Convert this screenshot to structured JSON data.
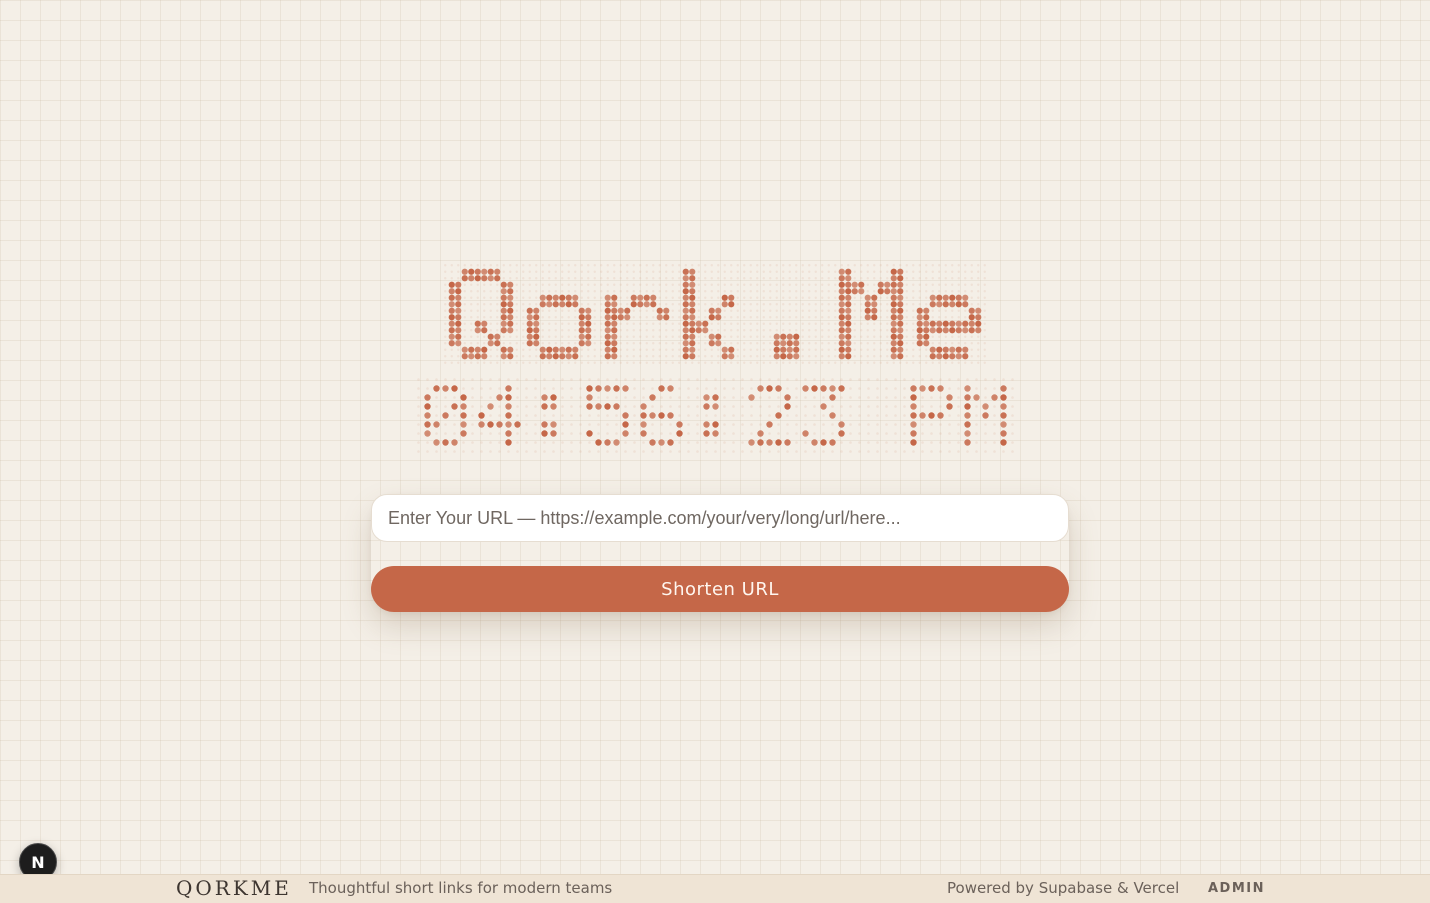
{
  "brand": {
    "display_text": "Qork.Me",
    "dot_color": "#c56748"
  },
  "clock": {
    "time_text": "04:56:23 PM"
  },
  "form": {
    "url_placeholder": "Enter Your URL — https://example.com/your/very/long/url/here...",
    "submit_label": "Shorten URL"
  },
  "dev_badge": {
    "label": "N"
  },
  "footer": {
    "logo": "QORKME",
    "tagline": "Thoughtful short links for modern teams",
    "powered_by": "Powered by Supabase & Vercel",
    "admin_label": "ADMIN"
  },
  "colors": {
    "background": "#f4efe7",
    "accent": "#c56748",
    "footer_bg": "#efe4d5",
    "text_muted": "#6b615a"
  }
}
